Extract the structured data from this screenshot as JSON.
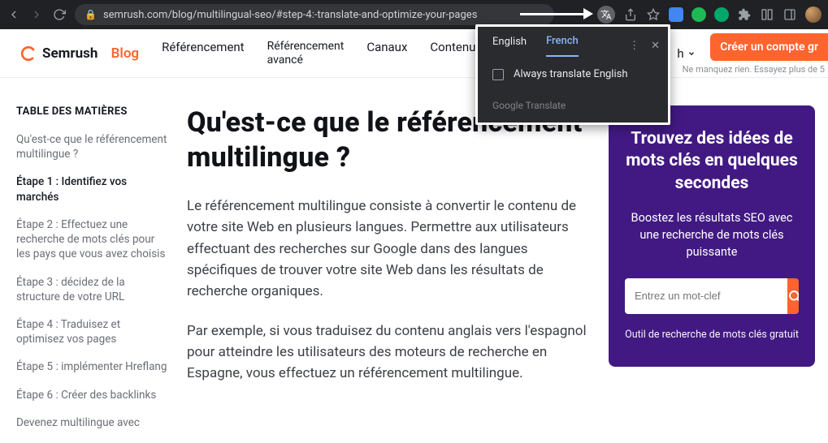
{
  "browser": {
    "url": "semrush.com/blog/multilingual-seo/#step-4:-translate-and-optimize-your-pages"
  },
  "translate_popup": {
    "tab_en": "English",
    "tab_fr": "French",
    "always": "Always translate English",
    "footer": "Google Translate"
  },
  "header": {
    "logo_brand": "Semrush",
    "logo_blog": "Blog",
    "nav": {
      "ref": "Référencement",
      "ref_adv_l1": "Référencement",
      "ref_adv_l2": "avancé",
      "canaux": "Canaux",
      "contenu": "Contenu",
      "search_trail": "h"
    },
    "cta": "Créer un compte gr",
    "subnote": "Ne manquez rien. Essayez plus de 5"
  },
  "toc": {
    "title": "TABLE DES MATIÈRES",
    "items": [
      "Qu'est-ce que le référencement multilingue ?",
      "Étape 1 : Identifiez vos marchés",
      "Étape 2 : Effectuez une recherche de mots clés pour les pays que vous avez choisis",
      "Étape 3 : décidez de la structure de votre URL",
      "Étape 4 : Traduisez et optimisez vos pages",
      "Étape 5 : implémenter Hreflang",
      "Étape 6 : Créer des backlinks",
      "Devenez multilingue avec"
    ],
    "active_index": 1
  },
  "article": {
    "h1": "Qu'est-ce que le référencement multilingue ?",
    "p1": "Le référencement multilingue consiste à convertir le contenu de votre site Web en plusieurs langues. Permettre aux utilisateurs effectuant des recherches sur Google dans des langues spécifiques de trouver votre site Web dans les résultats de recherche organiques.",
    "p2": "Par exemple, si vous traduisez du contenu anglais vers l'espagnol pour atteindre les utilisateurs des moteurs de recherche en Espagne, vous effectuez un référencement multilingue."
  },
  "promo": {
    "h2": "Trouvez des idées de mots clés en quelques secondes",
    "p": "Boostez les résultats SEO avec une recherche de mots clés puissante",
    "placeholder": "Entrez un mot-clef",
    "foot": "Outil de recherche de mots clés gratuit"
  }
}
